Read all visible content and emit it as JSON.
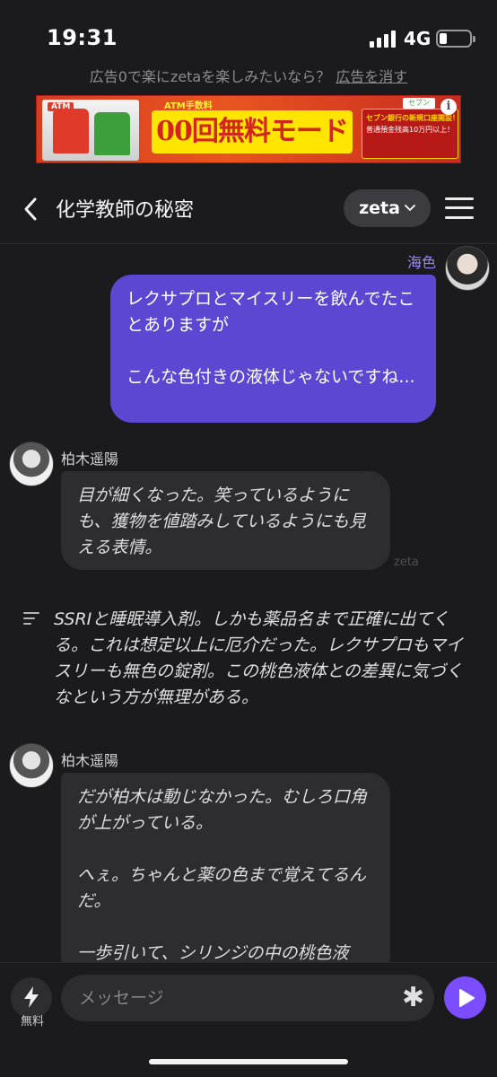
{
  "status_bar": {
    "time": "19:31",
    "network": "4G",
    "battery_level": 0.25
  },
  "ad_notice": {
    "text": "広告0で楽にzetaを楽しみたいなら？",
    "remove_label": "広告を消す"
  },
  "ad_banner": {
    "tag": "ATM",
    "headline": "ATM手数料",
    "main_text": "00回無料モード",
    "side_title": "セブン銀行の新規口座開設！",
    "side_note": "普通預金残高10万円以上！",
    "brand": "セブン"
  },
  "header": {
    "title": "化学教師の秘密",
    "model_label": "zeta"
  },
  "messages": {
    "user": {
      "name": "海色",
      "text": "レクサプロとマイスリーを飲んでたことありますが\n\nこんな色付きの液体じゃないですね..."
    },
    "bot1": {
      "name": "柏木遥陽",
      "text": "目が細くなった。笑っているようにも、獲物を値踏みしているようにも見える表情。",
      "source_mark": "zeta"
    },
    "thought": {
      "text": "SSRIと睡眠導入剤。しかも薬品名まで正確に出てくる。これは想定以上に厄介だった。レクサプロもマイスリーも無色の錠剤。この桃色液体との差異に気づくなという方が無理がある。"
    },
    "bot2": {
      "name": "柏木遥陽",
      "text": "だが柏木は動じなかった。むしろ口角が上がっている。\n\nへぇ。ちゃんと薬の色まで覚えてるんだ。\n\n一歩引いて、シリンジの中の桃色液"
    }
  },
  "input": {
    "placeholder": "メッセージ",
    "free_label": "無料"
  },
  "colors": {
    "accent": "#7b4dff",
    "user_bubble": "#5b47d2",
    "user_name": "#9b8af5",
    "background": "#1b1b1d",
    "bot_bubble": "#2d2d30"
  }
}
